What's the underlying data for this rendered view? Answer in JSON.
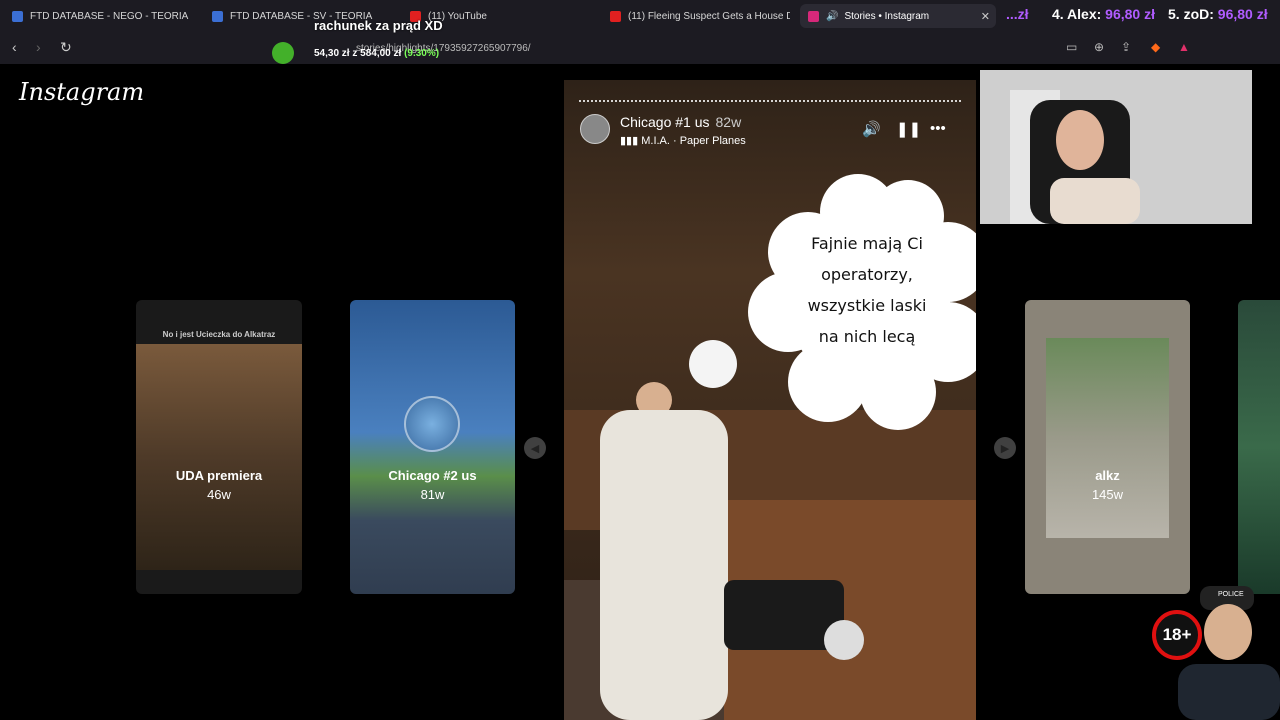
{
  "tabs": [
    {
      "title": "FTD DATABASE - NEGO - TEORIA",
      "favicon_color": "#3b6fd4"
    },
    {
      "title": "FTD DATABASE - SV - TEORIA",
      "favicon_color": "#3b6fd4"
    },
    {
      "title": "(11) YouTube",
      "favicon_color": "#e02020"
    },
    {
      "title": "(11) Fleeing Suspect Gets a House D",
      "favicon_color": "#e02020"
    },
    {
      "title": "Stories • Instagram",
      "favicon_color": "#d6287a"
    }
  ],
  "address_bar": {
    "url": "stories/highlights/17935927265907796/"
  },
  "overlay": {
    "caption": "rachunek za prąd XD",
    "progress_text": "54,30 zł z 584,00 zł",
    "progress_percent": "(9.30%)"
  },
  "scoreboard": [
    {
      "label": "zł",
      "value": "..."
    },
    {
      "label": "4. Alex:",
      "value": "96,80 zł"
    },
    {
      "label": "5. zoD:",
      "value": "96,80 zł"
    }
  ],
  "instagram": {
    "logo": "Instagram",
    "side_stories": [
      {
        "label": "UDA premiera",
        "age": "46w",
        "header": "No i jest Ucieczka do Alkatraz"
      },
      {
        "label": "Chicago #2 us",
        "age": "81w"
      },
      {
        "label": "alkz",
        "age": "145w"
      }
    ],
    "main_story": {
      "title": "Chicago #1 us",
      "age": "82w",
      "music": "M.I.A. · Paper Planes",
      "cloud_text": [
        "Fajnie mają Ci",
        "operatorzy,",
        "wszystkie laski",
        "na nich lecą"
      ]
    }
  },
  "badge": "18+"
}
